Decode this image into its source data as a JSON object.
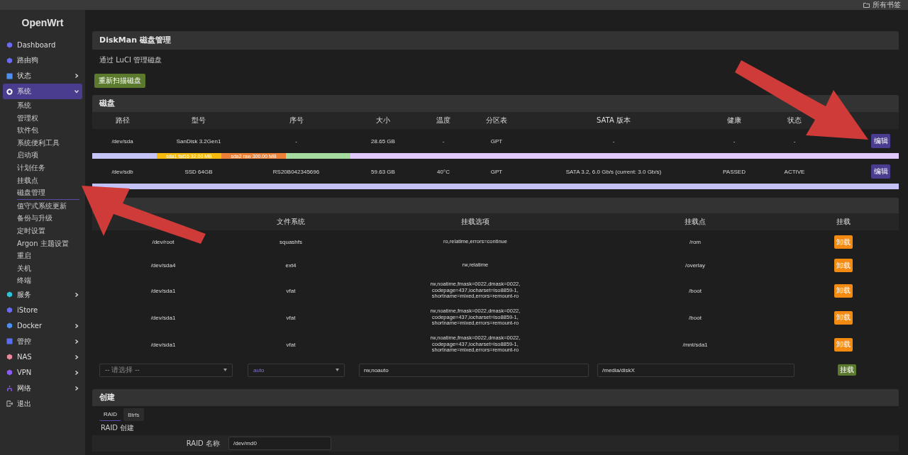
{
  "browser_bar": {
    "bookmarks": "所有书签"
  },
  "sidebar": {
    "logo": "OpenWrt",
    "items": [
      {
        "label": "Dashboard"
      },
      {
        "label": "路由狗"
      },
      {
        "label": "状态",
        "expanded": false
      },
      {
        "label": "系统",
        "expanded": true,
        "selected": true,
        "children": [
          {
            "label": "系统",
            "selected": false
          },
          {
            "label": "管理权",
            "selected": false
          },
          {
            "label": "软件包",
            "selected": false
          },
          {
            "label": "系统便利工具",
            "selected": false
          },
          {
            "label": "启动项",
            "selected": false
          },
          {
            "label": "计划任务",
            "selected": false
          },
          {
            "label": "挂载点",
            "selected": false
          },
          {
            "label": "磁盘管理",
            "selected": true
          },
          {
            "label": "值守式系统更新",
            "selected": false
          },
          {
            "label": "备份与升级",
            "selected": false
          },
          {
            "label": "定时设置",
            "selected": false
          },
          {
            "label": "Argon 主题设置",
            "selected": false
          },
          {
            "label": "重启",
            "selected": false
          },
          {
            "label": "关机",
            "selected": false
          },
          {
            "label": "终端",
            "selected": false
          }
        ]
      },
      {
        "label": "服务",
        "expanded": false
      },
      {
        "label": "iStore"
      },
      {
        "label": "Docker",
        "expanded": false
      },
      {
        "label": "管控",
        "expanded": false
      },
      {
        "label": "NAS",
        "expanded": false
      },
      {
        "label": "VPN",
        "expanded": false
      },
      {
        "label": "网络",
        "expanded": false
      },
      {
        "label": "退出"
      }
    ]
  },
  "page": {
    "title": "DiskMan 磁盘管理",
    "description": "通过 LuCI 管理磁盘",
    "rescan_button": "重新扫描磁盘"
  },
  "disks": {
    "title": "磁盘",
    "columns": [
      "路径",
      "型号",
      "序号",
      "大小",
      "温度",
      "分区表",
      "SATA 版本",
      "健康",
      "状态"
    ],
    "rows": [
      {
        "cells": [
          "/dev/sda",
          "SanDisk 3.2Gen1",
          "-",
          "28.65 GB",
          "-",
          "GPT",
          "-",
          "-",
          "-"
        ],
        "button": "编辑",
        "partitions": [
          {
            "kind": "part",
            "color": "#c5c5f7"
          },
          {
            "kind": "part",
            "color": "#f5bc0f",
            "label": "sda1 fat16 32.00 MB"
          },
          {
            "kind": "part",
            "color": "#ec8036",
            "label": "sda2 raw 300.00 MB"
          },
          {
            "kind": "part",
            "color": "#a6dba0"
          },
          {
            "kind": "free",
            "color": "#e2c9fb"
          }
        ]
      },
      {
        "cells": [
          "/dev/sdb",
          "SSD 64GB",
          "RS20B042345696",
          "59.63 GB",
          "40°C",
          "GPT",
          "SATA 3.2, 6.0 Gb/s (current: 3.0 Gb/s)",
          "PASSED",
          "ACTIVE"
        ],
        "button": "编辑",
        "partitions": [
          {
            "kind": "free",
            "color": "#c2c2f9"
          }
        ]
      }
    ]
  },
  "mounts": {
    "columns": [
      "文件系统",
      "挂载选项",
      "挂载点",
      "挂载"
    ],
    "rows": [
      {
        "device": "/dev/root",
        "fs": "squashfs",
        "options": [
          "ro,relatime,errors=continue"
        ],
        "mount_point": "/rom",
        "button": "卸载"
      },
      {
        "device": "/dev/sda4",
        "fs": "ext4",
        "options": [
          "rw,relatime"
        ],
        "mount_point": "/overlay",
        "button": "卸载"
      },
      {
        "device": "/dev/sda1",
        "fs": "vfat",
        "options": [
          "rw,noatime,fmask=0022,dmask=0022,",
          "codepage=437,iocharset=iso8859-1,",
          "shortname=mixed,errors=remount-ro"
        ],
        "mount_point": "/boot",
        "button": "卸载"
      },
      {
        "device": "/dev/sda1",
        "fs": "vfat",
        "options": [
          "rw,noatime,fmask=0022,dmask=0022,",
          "codepage=437,iocharset=iso8859-1,",
          "shortname=mixed,errors=remount-ro"
        ],
        "mount_point": "/boot",
        "button": "卸载"
      },
      {
        "device": "/dev/sda1",
        "fs": "vfat",
        "options": [
          "rw,noatime,fmask=0022,dmask=0022,",
          "codepage=437,iocharset=iso8859-1,",
          "shortname=mixed,errors=remount-ro"
        ],
        "mount_point": "/mnt/sda1",
        "button": "卸载"
      }
    ],
    "add": {
      "device_placeholder": "-- 请选择 --",
      "fs_value": "auto",
      "options_value": "rw,noauto",
      "mount_point_value": "/media/diskX",
      "button": "挂载"
    }
  },
  "create": {
    "title": "创建",
    "tabs": [
      {
        "label": "RAID",
        "selected": true
      },
      {
        "label": "Btrfs",
        "selected": false
      }
    ],
    "subtitle": "RAID 创建",
    "name_label": "RAID 名称",
    "name_value": "/dev/md0"
  }
}
